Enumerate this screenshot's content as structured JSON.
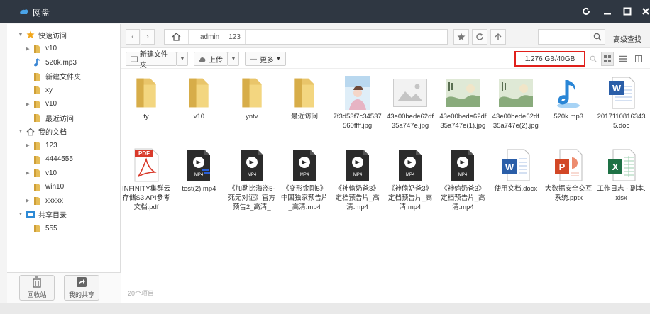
{
  "window": {
    "title": "网盘"
  },
  "sidebar": {
    "tree": [
      {
        "label": "快速访问",
        "depth": 0,
        "arrow": "▼",
        "icon": "star-icon"
      },
      {
        "label": "v10",
        "depth": 1,
        "arrow": "▶",
        "icon": "folder-icon"
      },
      {
        "label": "520k.mp3",
        "depth": 1,
        "arrow": "",
        "icon": "music-note-icon"
      },
      {
        "label": "新建文件夹",
        "depth": 1,
        "arrow": "",
        "icon": "folder-icon"
      },
      {
        "label": "xy",
        "depth": 1,
        "arrow": "",
        "icon": "folder-icon"
      },
      {
        "label": "v10",
        "depth": 1,
        "arrow": "▶",
        "icon": "folder-icon"
      },
      {
        "label": "最近访问",
        "depth": 1,
        "arrow": "",
        "icon": "folder-icon"
      },
      {
        "label": "我的文档",
        "depth": 0,
        "arrow": "▼",
        "icon": "home-icon"
      },
      {
        "label": "123",
        "depth": 1,
        "arrow": "▶",
        "icon": "folder-icon"
      },
      {
        "label": "4444555",
        "depth": 1,
        "arrow": "",
        "icon": "folder-icon"
      },
      {
        "label": "v10",
        "depth": 1,
        "arrow": "▶",
        "icon": "folder-icon"
      },
      {
        "label": "win10",
        "depth": 1,
        "arrow": "",
        "icon": "folder-icon"
      },
      {
        "label": "xxxxx",
        "depth": 1,
        "arrow": "▶",
        "icon": "folder-icon"
      },
      {
        "label": "共享目录",
        "depth": 0,
        "arrow": "▼",
        "icon": "share-folder-icon"
      },
      {
        "label": "555",
        "depth": 1,
        "arrow": "",
        "icon": "folder-icon"
      }
    ],
    "recycle_label": "回收站",
    "myshare_label": "我的共享"
  },
  "nav": {
    "breadcrumb": [
      "admin",
      "123"
    ],
    "advanced_search_label": "高级查找"
  },
  "toolbar": {
    "new_folder_label": "新建文件夹",
    "upload_label": "上传",
    "more_label": "更多",
    "quota": "1.276 GB/40GB"
  },
  "files": [
    {
      "name": "ty",
      "type": "folder"
    },
    {
      "name": "v10",
      "type": "folder"
    },
    {
      "name": "yntv",
      "type": "folder"
    },
    {
      "name": "最近访问",
      "type": "folder"
    },
    {
      "name": "7f3d53f7c34537560ffff.jpg",
      "type": "photo-fantasy"
    },
    {
      "name": "43e00bede62df35a747e.jpg",
      "type": "photo-placeholder"
    },
    {
      "name": "43e00bede62df35a747e(1).jpg",
      "type": "photo-poster"
    },
    {
      "name": "43e00bede62df35a747e(2).jpg",
      "type": "photo-poster"
    },
    {
      "name": "520k.mp3",
      "type": "mp3"
    },
    {
      "name": "20171108163435.doc",
      "type": "doc"
    },
    {
      "name": "INFINITY集群云存储S3 API参考文档.pdf",
      "type": "pdf"
    },
    {
      "name": "test(2).mp4",
      "type": "mp4-blue"
    },
    {
      "name": "《加勒比海盗5-死无对证》官方预告2_高清_",
      "type": "mp4"
    },
    {
      "name": "《变形金刚5》中国独家预告片_高清.mp4",
      "type": "mp4"
    },
    {
      "name": "《神偷奶爸3》定档预告片_高清.mp4",
      "type": "mp4"
    },
    {
      "name": "《神偷奶爸3》定档预告片_高清.mp4",
      "type": "mp4"
    },
    {
      "name": "《神偷奶爸3》定档预告片_高清.mp4",
      "type": "mp4"
    },
    {
      "name": "使用文档.docx",
      "type": "docx"
    },
    {
      "name": "大数据安全交互系统.pptx",
      "type": "pptx"
    },
    {
      "name": "工作日志 - 副本.xlsx",
      "type": "xlsx"
    }
  ],
  "footer": {
    "count": "20个项目"
  },
  "colors": {
    "titlebar": "#2f3742",
    "folder": "#e9c56a",
    "highlight": "#e0201b"
  }
}
